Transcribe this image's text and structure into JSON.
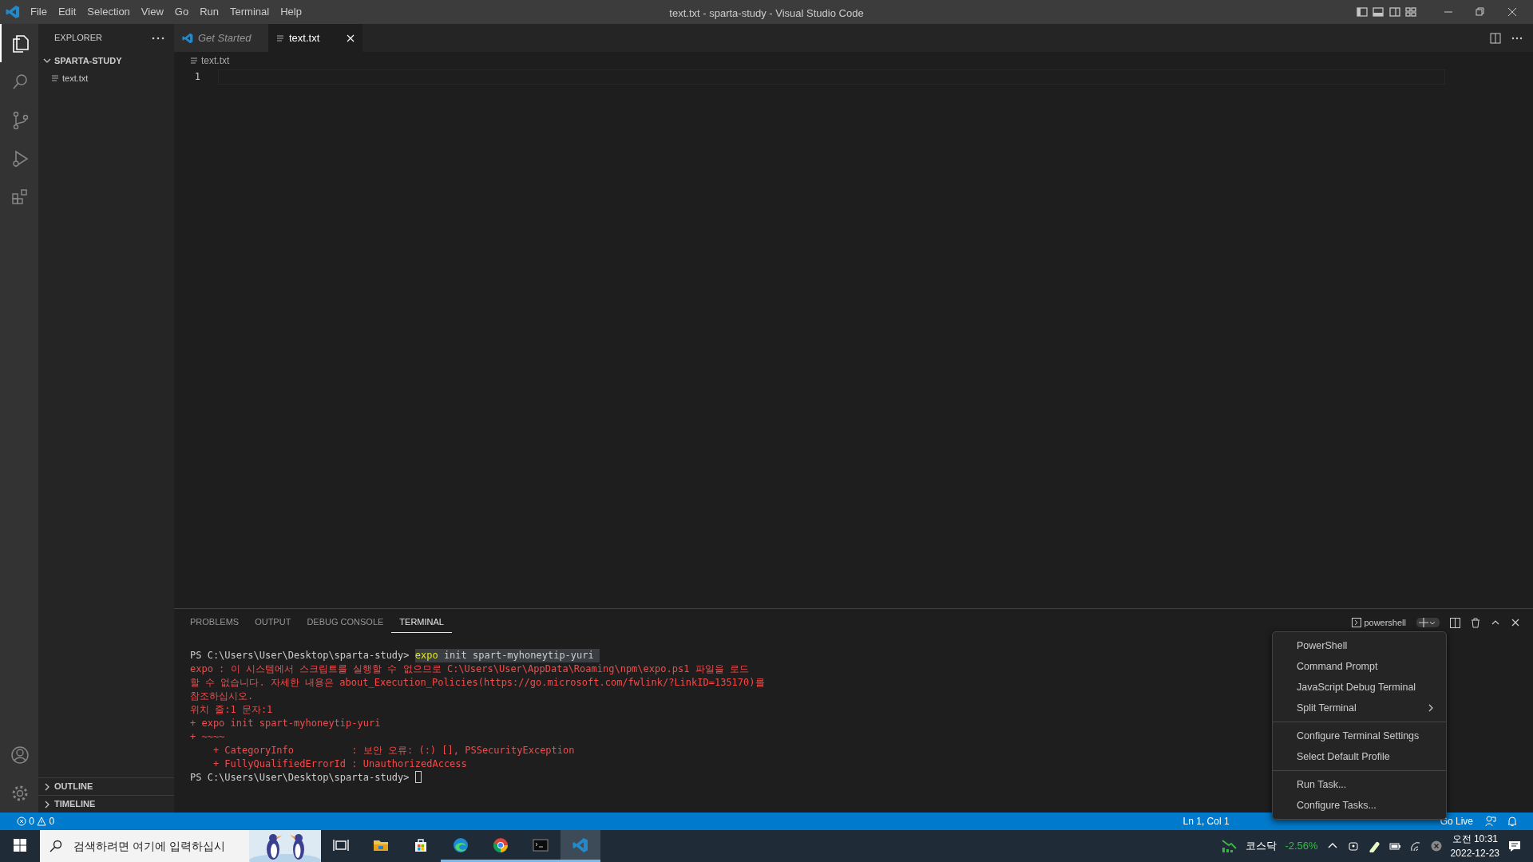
{
  "title_bar": {
    "menus": [
      "File",
      "Edit",
      "Selection",
      "View",
      "Go",
      "Run",
      "Terminal",
      "Help"
    ],
    "title": "text.txt - sparta-study - Visual Studio Code"
  },
  "activity_bar": [
    {
      "kind": "explorer",
      "selected": true
    },
    {
      "kind": "search",
      "selected": false
    },
    {
      "kind": "source-control",
      "selected": false
    },
    {
      "kind": "run",
      "selected": false
    },
    {
      "kind": "extensions",
      "selected": false
    }
  ],
  "sidebar": {
    "title": "EXPLORER",
    "folder": {
      "name": "SPARTA-STUDY",
      "expanded": true,
      "children": [
        {
          "name": "text.txt"
        }
      ]
    },
    "sections": [
      {
        "name": "OUTLINE",
        "expanded": false
      },
      {
        "name": "TIMELINE",
        "expanded": false
      }
    ]
  },
  "tabs": [
    {
      "label": "Get Started",
      "kind": "welcome",
      "preview": true,
      "selected": false
    },
    {
      "label": "text.txt",
      "kind": "text",
      "preview": false,
      "selected": true
    }
  ],
  "breadcrumb": "text.txt",
  "editor": {
    "line_numbers": [
      "1"
    ]
  },
  "panel": {
    "tabs": [
      {
        "label": "PROBLEMS",
        "selected": false
      },
      {
        "label": "OUTPUT",
        "selected": false
      },
      {
        "label": "DEBUG CONSOLE",
        "selected": false
      },
      {
        "label": "TERMINAL",
        "selected": true
      }
    ],
    "terminal_name": "powershell",
    "lines": [
      {
        "kind": "prompt",
        "prompt": "PS C:\\Users\\User\\Desktop\\sparta-study> ",
        "command_head": "expo",
        "command_rest": " init spart-myhoneytip-yuri"
      },
      {
        "kind": "error",
        "text": "expo : 이 시스템에서 스크립트를 실행할 수 없으므로 C:\\Users\\User\\AppData\\Roaming\\npm\\expo.ps1 파일을 로드"
      },
      {
        "kind": "error",
        "text": "할 수 없습니다. 자세한 내용은 about_Execution_Policies(https://go.microsoft.com/fwlink/?LinkID=135170)를"
      },
      {
        "kind": "error",
        "text": "참조하십시오."
      },
      {
        "kind": "error",
        "text": "위치 줄:1 문자:1"
      },
      {
        "kind": "error",
        "text": "+ expo init spart-myhoneytip-yuri"
      },
      {
        "kind": "error",
        "text": "+ ~~~~"
      },
      {
        "kind": "error",
        "text": "    + CategoryInfo          : 보안 오류: (:) [], PSSecurityException"
      },
      {
        "kind": "error",
        "text": "    + FullyQualifiedErrorId : UnauthorizedAccess"
      },
      {
        "kind": "prompt",
        "prompt": "PS C:\\Users\\User\\Desktop\\sparta-study> ",
        "cursor": true
      }
    ]
  },
  "menu": {
    "groups": [
      [
        {
          "label": "PowerShell",
          "submenu": false
        },
        {
          "label": "Command Prompt",
          "submenu": false
        },
        {
          "label": "JavaScript Debug Terminal",
          "submenu": false
        },
        {
          "label": "Split Terminal",
          "submenu": true
        }
      ],
      [
        {
          "label": "Configure Terminal Settings",
          "submenu": false
        },
        {
          "label": "Select Default Profile",
          "submenu": false
        }
      ],
      [
        {
          "label": "Run Task...",
          "submenu": false
        },
        {
          "label": "Configure Tasks...",
          "submenu": false
        }
      ]
    ]
  },
  "status_bar": {
    "errors": "0",
    "warnings": "0",
    "items": [
      "Ln 1, Col 1",
      "Go Live"
    ]
  },
  "taskbar": {
    "search": {
      "placeholder": "검색하려면 여기에 입력하십시"
    },
    "apps": [
      {
        "kind": "task-view",
        "running": false,
        "selected": false
      },
      {
        "kind": "file-explorer",
        "running": false,
        "selected": false
      },
      {
        "kind": "store",
        "running": false,
        "selected": false
      },
      {
        "kind": "edge",
        "running": true,
        "selected": false
      },
      {
        "kind": "chrome",
        "running": true,
        "selected": false
      },
      {
        "kind": "terminal",
        "running": true,
        "selected": false
      },
      {
        "kind": "vscode",
        "running": true,
        "selected": true
      }
    ],
    "stock": {
      "name": "코스닥",
      "change": "-2.56%"
    },
    "clock": {
      "time": "오전 10:31",
      "date": "2022-12-23"
    }
  }
}
